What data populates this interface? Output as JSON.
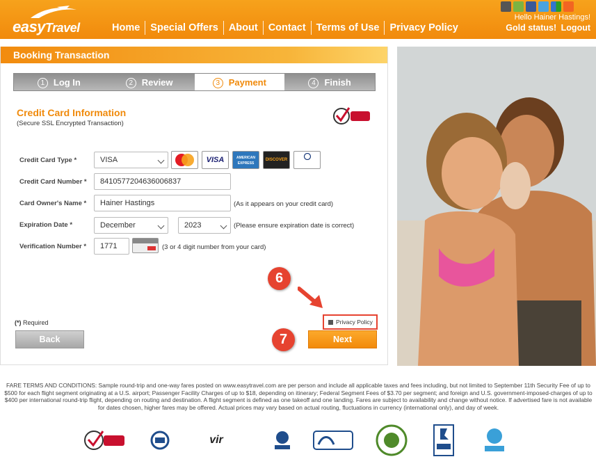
{
  "header": {
    "brand": "easy",
    "brand_rest": "Travel",
    "nav": [
      "Home",
      "Special Offers",
      "About",
      "Contact",
      "Terms of Use",
      "Privacy Policy"
    ],
    "social_icons": [
      "apple-icon",
      "android-icon",
      "facebook-icon",
      "twitter-icon",
      "delicious-icon",
      "rss-icon"
    ],
    "greeting": "Hello Hainer Hastings!",
    "status": "Gold status!",
    "logout": "Logout"
  },
  "booking": {
    "panel_title": "Booking Transaction",
    "steps": [
      {
        "num": "1",
        "label": "Log In"
      },
      {
        "num": "2",
        "label": "Review"
      },
      {
        "num": "3",
        "label": "Payment"
      },
      {
        "num": "4",
        "label": "Finish"
      }
    ],
    "active_step": "Payment",
    "section_title": "Credit Card Information",
    "section_subtitle": "(Secure SSL Encrypted Transaction)",
    "verisign_label": "VeriSign Secured",
    "fields": {
      "card_type_label": "Credit Card Type",
      "card_type_value": "VISA",
      "card_number_label": "Credit Card Number",
      "card_number_value": "8410577204636006837",
      "owner_label": "Card Owner's Name",
      "owner_value": "Hainer Hastings",
      "owner_hint": "(As it appears on your credit card)",
      "expiration_label": "Expiration Date",
      "exp_month": "December",
      "exp_year": "2023",
      "expiration_hint": "(Please ensure expiration date is correct)",
      "cvv_label": "Verification Number",
      "cvv_value": "1771",
      "cvv_hint": "(3 or 4 digit number from your card)",
      "asterisk": "*"
    },
    "card_logos": [
      "MasterCard",
      "VISA",
      "AMERICAN EXPRESS",
      "DISCOVER",
      "Diners Club International"
    ],
    "required_note": "Required",
    "required_mark": "(*)",
    "privacy_link": "Privacy Policy",
    "back_button": "Back",
    "next_button": "Next",
    "markers": [
      "6",
      "7"
    ]
  },
  "footer": {
    "terms": "FARE TERMS AND CONDITIONS: Sample round-trip and one-way fares posted on www.easytravel.com are per person and include all applicable taxes and fees including, but not limited to September 11th Security Fee of up to $500 for each flight segment originating at a U.S. airport; Passenger Facility Charges of up to $18, depending on itinerary; Federal Segment Fees of $3.70 per segment; and foreign and U.S. government-imposed-charges of up to $400 per international round-trip flight, depending on routing and destination. A flight segment is defined as one takeoff and one landing. Fares are subject to availability and change without notice. If advertised fare is not available for dates chosen, higher fares may be offered. Actual prices may vary based on actual routing, fluctuations in currency (international only), and day of week.",
    "badges": [
      "VeriSign Secured",
      "TÜV",
      "vir",
      "IATA",
      "ARC",
      "ASTA",
      "BBB",
      "IATA"
    ]
  },
  "colors": {
    "brand_orange": "#f28a0b",
    "marker_red": "#e64330"
  }
}
